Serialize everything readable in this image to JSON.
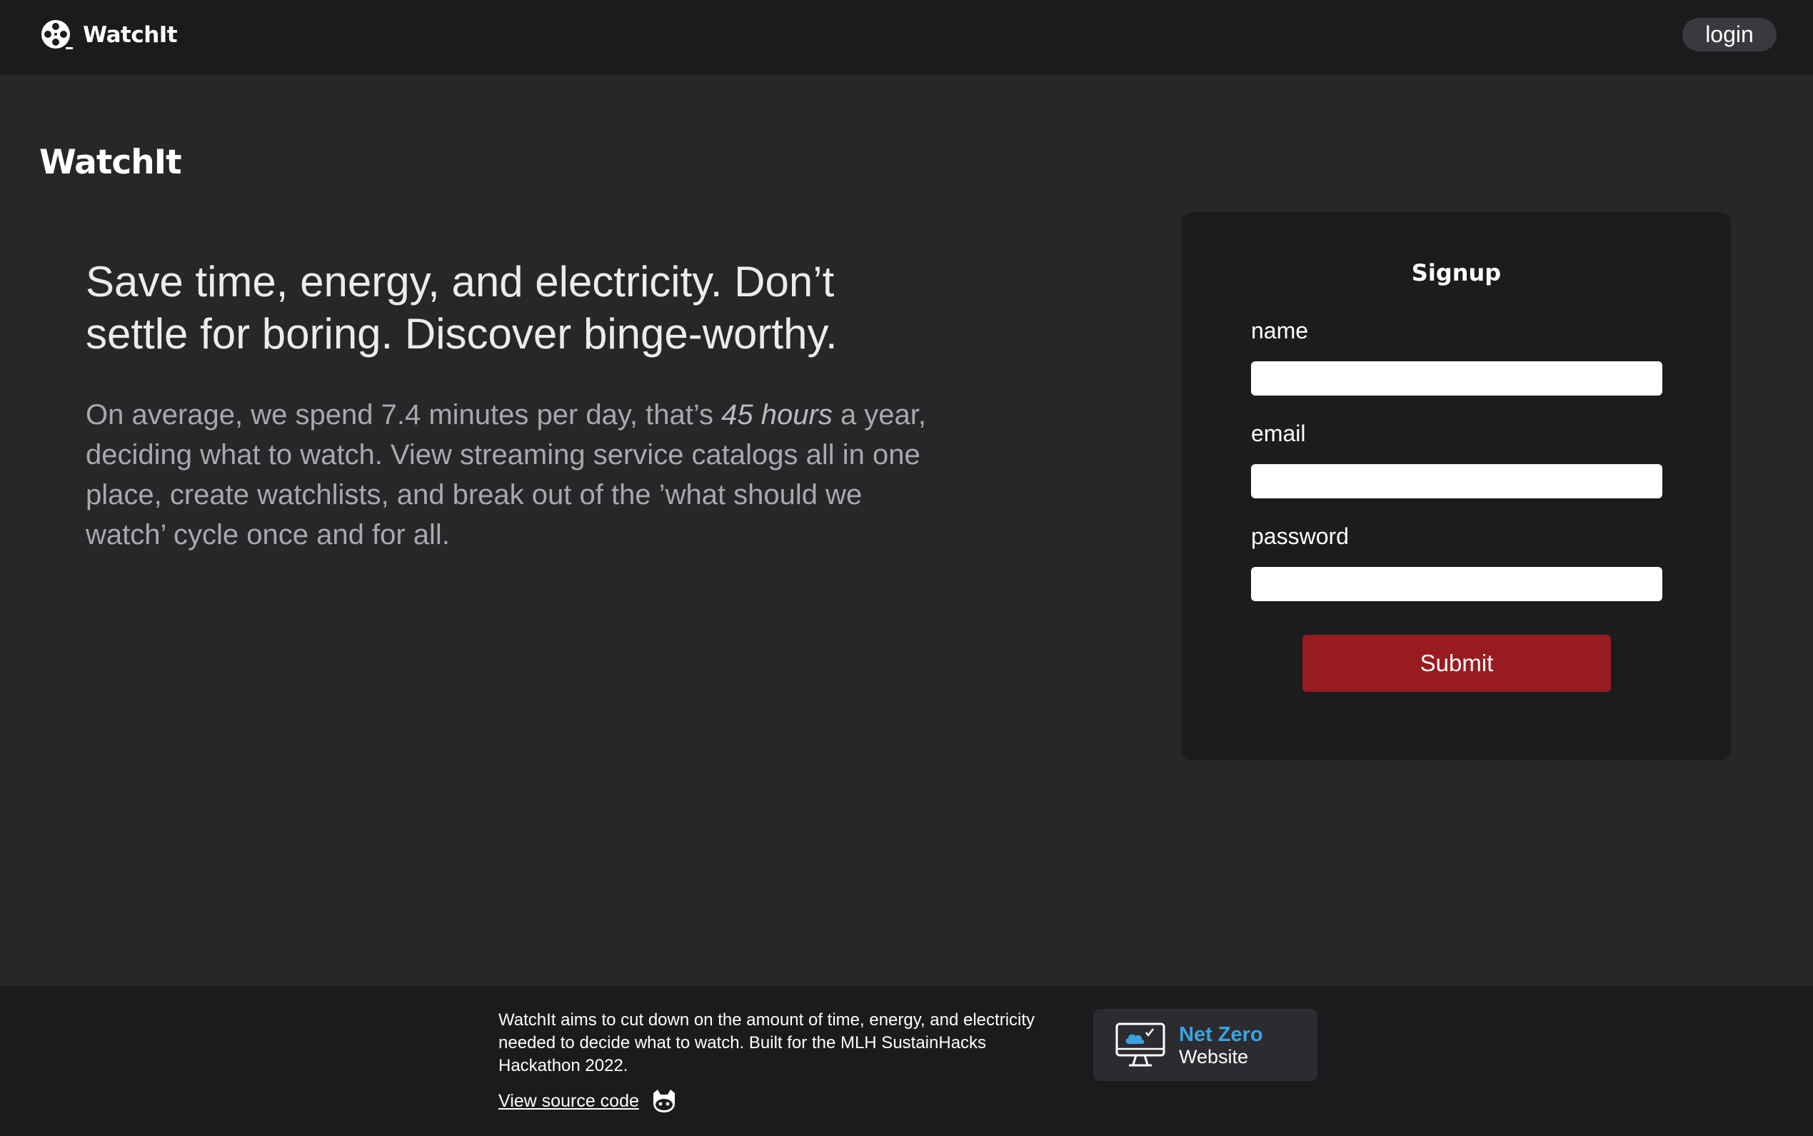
{
  "header": {
    "brand": "WatchIt",
    "login_label": "login"
  },
  "main": {
    "heading": "WatchIt",
    "headline": "Save time, energy, and electricity. Don’t settle for boring. Discover binge-worthy.",
    "body_before": "On average, we spend 7.4 minutes per day, that’s ",
    "body_emphasis": "45 hours",
    "body_after": " a year, deciding what to watch. View streaming service catalogs all in one place, create watchlists, and break out of the ’what should we watch’ cycle once and for all."
  },
  "signup": {
    "title": "Signup",
    "name_label": "name",
    "name_value": "",
    "email_label": "email",
    "email_value": "",
    "password_label": "password",
    "password_value": "",
    "submit_label": "Submit"
  },
  "footer": {
    "description": "WatchIt aims to cut down on the amount of time, energy, and electricity needed to decide what to watch. Built for the MLH SustainHacks Hackathon 2022.",
    "source_link": "View source code",
    "badge_title": "Net Zero",
    "badge_subtitle": "Website"
  },
  "colors": {
    "background": "#27272a",
    "bar": "#1b1b1d",
    "card": "#1c1c1e",
    "submit": "#981b20",
    "accent_blue": "#3ba3e0"
  },
  "icons": {
    "brand": "film-reel-icon",
    "source": "github-icon",
    "badge": "monitor-cloud-icon"
  }
}
